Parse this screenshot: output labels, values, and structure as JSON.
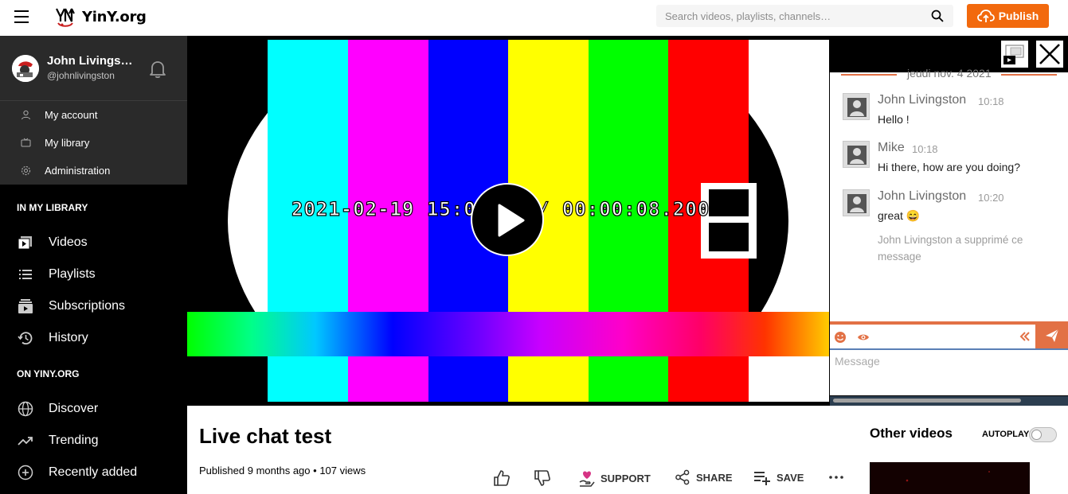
{
  "header": {
    "site_name": "YinY.org",
    "search_placeholder": "Search videos, playlists, channels…",
    "publish_label": "Publish"
  },
  "user": {
    "name": "John Livings…",
    "handle": "@johnlivingston"
  },
  "account_menu": [
    {
      "label": "My account",
      "icon": "user-icon"
    },
    {
      "label": "My library",
      "icon": "tv-icon"
    },
    {
      "label": "Administration",
      "icon": "gear-icon"
    }
  ],
  "library_section": {
    "title": "IN MY LIBRARY",
    "items": [
      {
        "label": "Videos",
        "icon": "videos-icon"
      },
      {
        "label": "Playlists",
        "icon": "list-icon"
      },
      {
        "label": "Subscriptions",
        "icon": "subscriptions-icon"
      },
      {
        "label": "History",
        "icon": "history-icon"
      }
    ]
  },
  "site_section": {
    "title": "ON YINY.ORG",
    "items": [
      {
        "label": "Discover",
        "icon": "globe-icon"
      },
      {
        "label": "Trending",
        "icon": "trending-icon"
      },
      {
        "label": "Recently added",
        "icon": "plus-circle-icon"
      }
    ]
  },
  "player": {
    "overlay_timestamp": "2021-02-19 15:05:34 / 00:00:08.200"
  },
  "chat": {
    "date": "jeudi nov. 4 2021",
    "messages": [
      {
        "author": "John Livingston",
        "time": "10:18",
        "text": "Hello !"
      },
      {
        "author": "Mike",
        "time": "10:18",
        "text": "Hi there, how are you doing?"
      },
      {
        "author": "John Livingston",
        "time": "10:20",
        "text": "great 😄"
      }
    ],
    "deleted_notice": "John Livingston a supprimé ce message",
    "input_placeholder": "Message"
  },
  "video": {
    "title": "Live chat test",
    "published_prefix": "Published",
    "published_ago": "9 months ago",
    "views": "107 views",
    "actions": {
      "support": "SUPPORT",
      "share": "SHARE",
      "save": "SAVE"
    }
  },
  "sidebar_right": {
    "title": "Other videos",
    "autoplay_label": "AUTOPLAY",
    "autoplay_on": false
  },
  "colors": {
    "accent": "#f2690d",
    "chat_accent": "#e27145",
    "sidebar_bg": "#000000",
    "user_block_bg": "#2a2a2a"
  }
}
